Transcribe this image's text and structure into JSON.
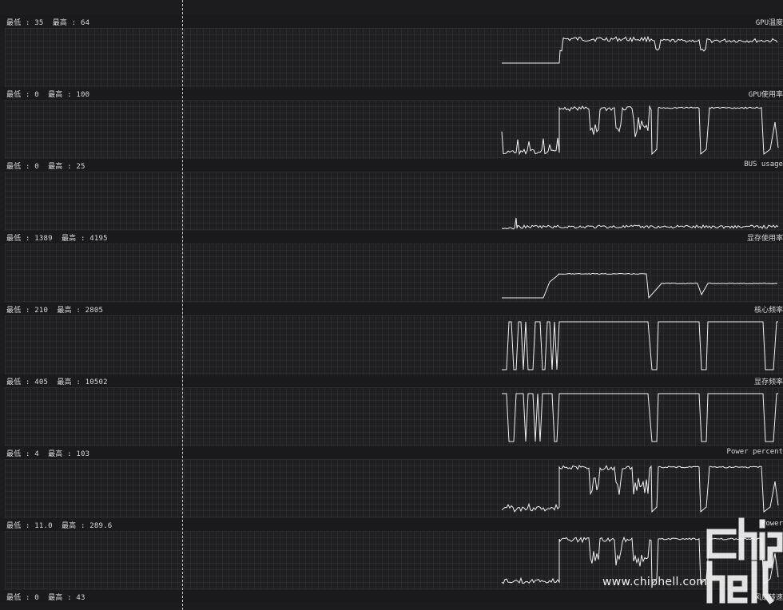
{
  "lanes": [
    {
      "id": "gpu-temp",
      "range_text": "最低 : 35  最高 : 64",
      "title": "GPU温度"
    },
    {
      "id": "gpu-usage",
      "range_text": "最低 : 0  最高 : 100",
      "title": "GPU使用率"
    },
    {
      "id": "bus-usage",
      "range_text": "最低 : 0  最高 : 25",
      "title": "BUS usage"
    },
    {
      "id": "vram-usage",
      "range_text": "最低 : 1389  最高 : 4195",
      "title": "显存使用率"
    },
    {
      "id": "core-clock",
      "range_text": "最低 : 210  最高 : 2805",
      "title": "核心频率"
    },
    {
      "id": "memory-clock",
      "range_text": "最低 : 405  最高 : 10502",
      "title": "显存频率"
    },
    {
      "id": "power-percent",
      "range_text": "最低 : 4  最高 : 103",
      "title": "Power percent"
    },
    {
      "id": "power",
      "range_text": "最低 : 11.0  最高 : 289.6",
      "title": "Power"
    },
    {
      "id": "fan-speed",
      "range_text": "最低 : 0  最高 : 43",
      "title": "风扇转速"
    }
  ],
  "watermark": {
    "url": "www.chiphell.com",
    "logo_text": "chiphell"
  },
  "colors": {
    "background": "#1c1c1e",
    "grid": "#2b2b2e",
    "trace": "#f0f0f0"
  }
}
